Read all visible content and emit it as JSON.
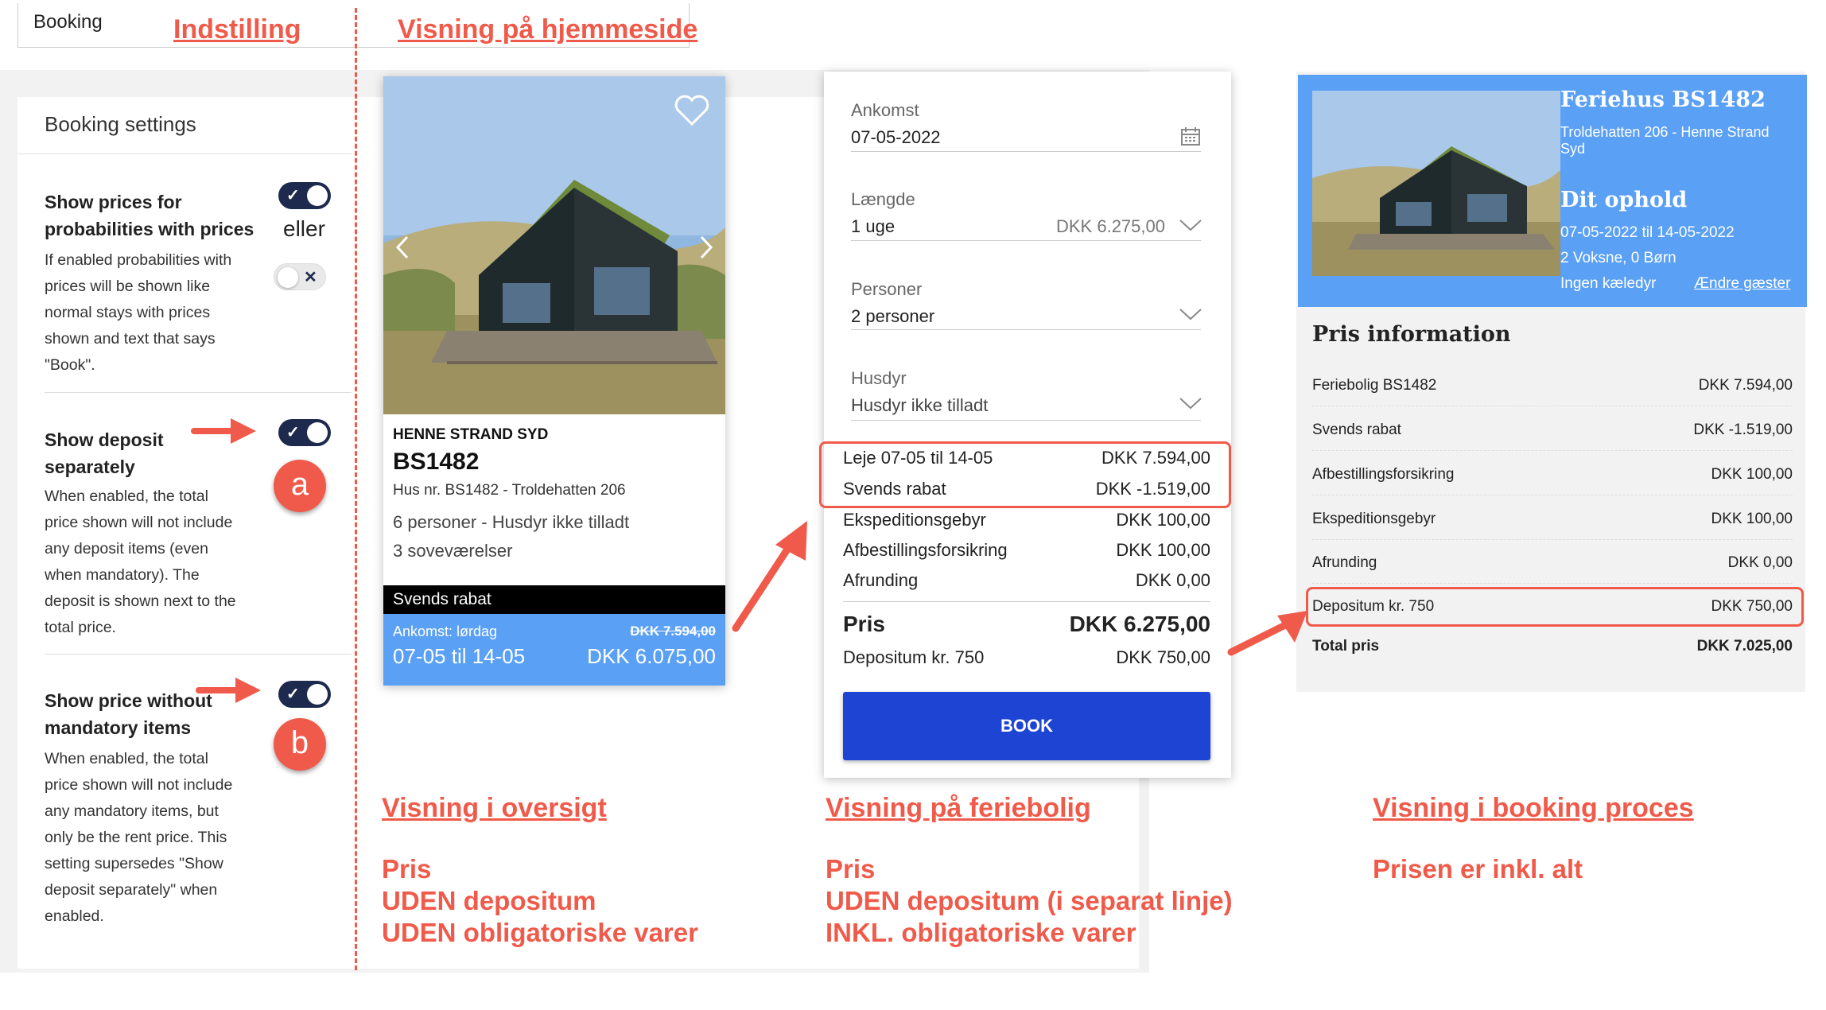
{
  "top_tab": {
    "label": "Booking"
  },
  "headers": {
    "indstilling": "Indstilling",
    "visning_hjemmeside": "Visning på hjemmeside"
  },
  "settings": {
    "title": "Booking settings",
    "or_label": "eller",
    "items": [
      {
        "title_lines": [
          "Show prices for",
          "probabilities with prices"
        ],
        "desc_lines": [
          "If enabled probabilities with",
          "prices will be shown like",
          "normal stays with prices",
          "shown and text that says",
          "\"Book\"."
        ]
      },
      {
        "title_lines": [
          "Show deposit",
          "separately"
        ],
        "desc_lines": [
          "When enabled, the total",
          "price shown will not include",
          "any deposit items (even",
          "when mandatory). The",
          "deposit is shown next to the",
          "total price."
        ],
        "badge": "a"
      },
      {
        "title_lines": [
          "Show price without",
          "mandatory items"
        ],
        "desc_lines": [
          "When enabled, the total",
          "price shown will not include",
          "any mandatory items, but",
          "only be the rent price. This",
          "setting supersedes \"Show",
          "deposit separately\" when",
          "enabled."
        ],
        "badge": "b"
      }
    ]
  },
  "card": {
    "location": "HENNE STRAND SYD",
    "code": "BS1482",
    "address": "Hus nr. BS1482 - Troldehatten 206",
    "persons": "6 personer - Husdyr ikke tilladt",
    "rooms": "3 soveværelser",
    "discount_label": "Svends rabat",
    "arrival_label": "Ankomst: lørdag",
    "old_price": "DKK 7.594,00",
    "dates": "07-05 til 14-05",
    "price": "DKK 6.075,00"
  },
  "form": {
    "arrival_label": "Ankomst",
    "arrival_value": "07-05-2022",
    "length_label": "Længde",
    "length_value": "1 uge",
    "length_price": "DKK 6.275,00",
    "persons_label": "Personer",
    "persons_value": "2 personer",
    "pets_label": "Husdyr",
    "pets_value": "Husdyr ikke tilladt",
    "lines": [
      {
        "label": "Leje 07-05 til 14-05",
        "value": "DKK 7.594,00"
      },
      {
        "label": "Svends rabat",
        "value": "DKK -1.519,00"
      },
      {
        "label": "Ekspeditionsgebyr",
        "value": "DKK 100,00"
      },
      {
        "label": "Afbestillingsforsikring",
        "value": "DKK 100,00"
      },
      {
        "label": "Afrunding",
        "value": "DKK 0,00"
      }
    ],
    "total_label": "Pris",
    "total_value": "DKK 6.275,00",
    "deposit_label": "Depositum kr. 750",
    "deposit_value": "DKK 750,00",
    "book_button": "BOOK"
  },
  "booking": {
    "house_title": "Feriehus BS1482",
    "house_address_lines": [
      "Troldehatten 206 - Henne Strand",
      "Syd"
    ],
    "stay_title": "Dit ophold",
    "stay_dates": "07-05-2022 til 14-05-2022",
    "guests": "2 Voksne, 0 Børn",
    "pets": "Ingen kæledyr",
    "change_guests": "Ændre gæster",
    "price_info_title": "Pris information",
    "lines": [
      {
        "label": "Feriebolig BS1482",
        "value": "DKK 7.594,00"
      },
      {
        "label": "Svends rabat",
        "value": "DKK -1.519,00"
      },
      {
        "label": "Afbestillingsforsikring",
        "value": "DKK 100,00"
      },
      {
        "label": "Ekspeditionsgebyr",
        "value": "DKK 100,00"
      },
      {
        "label": "Afrunding",
        "value": "DKK 0,00"
      },
      {
        "label": "Depositum kr. 750",
        "value": "DKK 750,00"
      }
    ],
    "total_label": "Total pris",
    "total_value": "DKK 7.025,00"
  },
  "annotations": {
    "oversigt_title": "Visning i oversigt",
    "oversigt_lines": [
      "Pris",
      "UDEN depositum",
      "UDEN obligatoriske varer"
    ],
    "feriebolig_title": "Visning på feriebolig",
    "feriebolig_lines": [
      "Pris",
      "UDEN depositum (i separat linje)",
      "INKL. obligatoriske varer"
    ],
    "booking_title": "Visning i booking proces",
    "booking_lines": [
      "Prisen er inkl. alt"
    ]
  },
  "colors": {
    "accent_red": "#f05a4a",
    "navy": "#1d2a4e",
    "blue_button": "#1e44d4",
    "light_blue": "#5aa0f5"
  }
}
